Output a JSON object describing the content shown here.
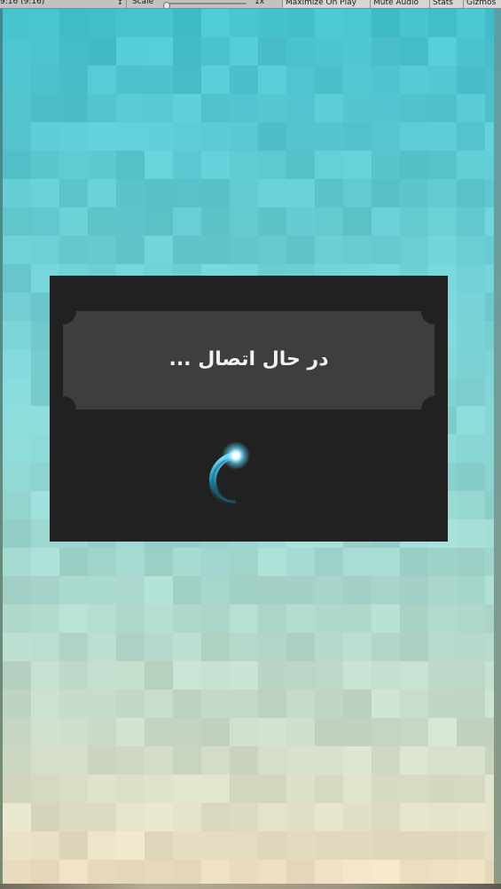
{
  "toolbar": {
    "aspect_label": "9:16 (9:16)",
    "aspect_arrow": "↕",
    "scale_label": "Scale",
    "scale_value": "1x",
    "scale_fraction": 0.0,
    "maximize_on_play": "Maximize On Play",
    "mute_audio": "Mute Audio",
    "stats": "Stats",
    "gizmos": "Gizmos"
  },
  "dialog": {
    "status_text": "در حال اتصال ...",
    "spinner_icon": "loading-spinner-icon"
  },
  "colors": {
    "dialog_bg": "#212121",
    "banner_bg": "#3e3e3e",
    "text": "#f2f2f2",
    "spinner_glow": "#8ee8ff",
    "background_top": "#4cc6d2",
    "background_bottom": "#ecdcc0"
  }
}
